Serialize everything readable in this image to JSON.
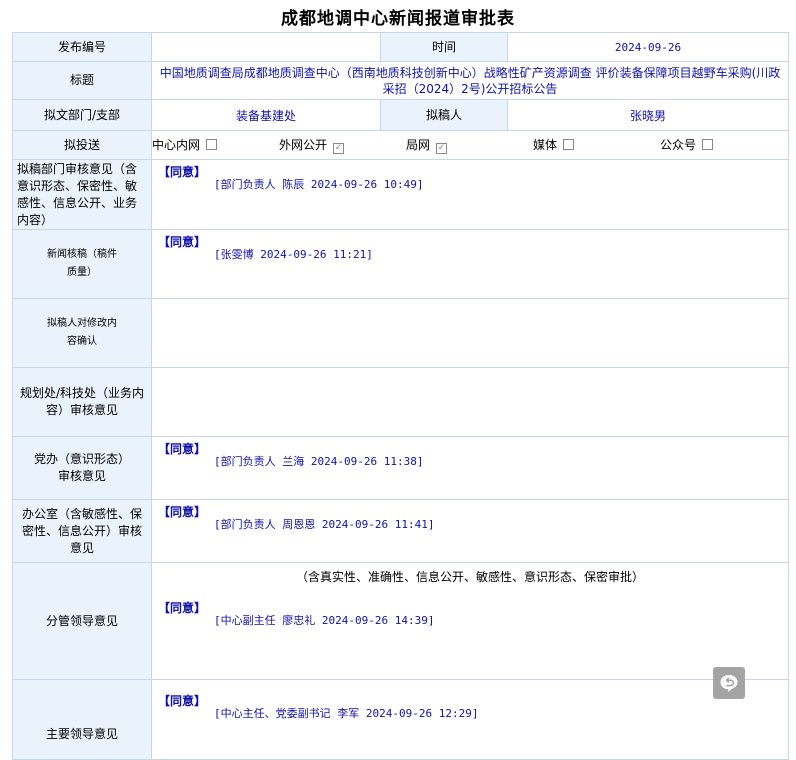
{
  "title": "成都地调中心新闻报道审批表",
  "header": {
    "pub_no_label": "发布编号",
    "pub_no_value": "",
    "time_label": "时间",
    "time_value": "2024-09-26",
    "subject_label": "标题",
    "subject_value": "中国地质调查局成都地质调查中心（西南地质科技创新中心）战略性矿产资源调查 评价装备保障项目越野车采购(川政采招（2024）2号)公开招标公告",
    "dept_label": "拟文部门/支部",
    "dept_value": "装备基建处",
    "drafter_label": "拟稿人",
    "drafter_value": "张晓男"
  },
  "channels": {
    "label": "拟投送",
    "items": [
      {
        "label": "中心内网",
        "checked": false
      },
      {
        "label": "外网公开",
        "checked": true
      },
      {
        "label": "局网",
        "checked": true
      },
      {
        "label": "媒体",
        "checked": false
      },
      {
        "label": "公众号",
        "checked": false
      }
    ]
  },
  "opinions": {
    "dept_review": {
      "label": "拟稿部门审核意见（含意识形态、保密性、敏感性、信息公开、业务内容）",
      "decision": "【同意】",
      "signature": "[部门负责人 陈辰 2024-09-26 10:49]"
    },
    "news_check": {
      "label": "新闻核稿（稿件质量）",
      "decision": "【同意】",
      "signature": "[张雯博 2024-09-26 11:21]"
    },
    "drafter_confirm": {
      "label": "拟稿人对修改内容确认"
    },
    "planning_review": {
      "label": "规划处/科技处（业务内容）审核意见"
    },
    "party_office": {
      "label": "党办（意识形态）审核意见",
      "decision": "【同意】",
      "signature": "[部门负责人 兰海 2024-09-26 11:38]"
    },
    "office": {
      "label": "办公室（含敏感性、保密性、信息公开）审核意见",
      "decision": "【同意】",
      "signature": "[部门负责人 周恩恩 2024-09-26 11:41]"
    },
    "deputy_leader": {
      "label": "分管领导意见",
      "criteria": "（含真实性、准确性、信息公开、敏感性、意识形态、保密审批）",
      "decision": "【同意】",
      "signature": "[中心副主任 廖忠礼 2024-09-26 14:39]"
    },
    "main_leader": {
      "label": "主要领导意见",
      "decision": "【同意】",
      "signature": "[中心主任、党委副书记 李军 2024-09-26 12:29]"
    }
  },
  "icons": {
    "floating_button": "back-reply-icon"
  },
  "colors": {
    "label_bg": "#eaf2fb",
    "border": "#c5d5ea",
    "value_text": "#1111aa",
    "fab_bg": "#a4a4a4"
  }
}
